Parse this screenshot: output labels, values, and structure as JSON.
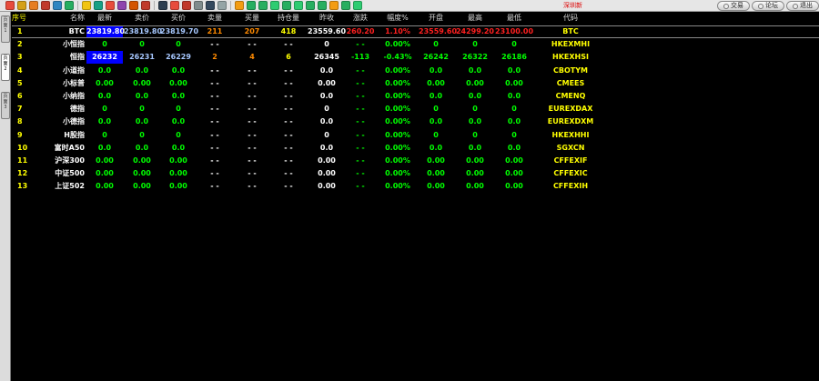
{
  "toolbar": {
    "status_text": "深圳新",
    "buttons": [
      {
        "label": "交易"
      },
      {
        "label": "论坛"
      },
      {
        "label": "退出"
      }
    ],
    "icons": [
      "house-icon",
      "stop-icon",
      "notebook-icon",
      "folder-icon",
      "table-icon",
      "grid-icon",
      "search-icon",
      "zoom-icon",
      "pointer-icon",
      "paint-icon",
      "pin-icon",
      "filter-icon",
      "grid2-icon",
      "chart-icon",
      "line-chart-icon",
      "list-icon",
      "table2-icon",
      "window-icon",
      "box1-icon",
      "box2-icon",
      "box3-icon",
      "box4-icon",
      "box5-icon",
      "box6-icon",
      "box7-icon",
      "box8-icon",
      "box9-icon",
      "box10-icon",
      "box11-icon"
    ]
  },
  "sidebar": {
    "tabs": [
      "页面 1",
      "页面 2",
      "页面 3"
    ]
  },
  "table": {
    "headers": [
      "序号",
      "名称",
      "最新",
      "卖价",
      "买价",
      "卖量",
      "买量",
      "持仓量",
      "昨收",
      "涨跌",
      "幅度%",
      "开盘",
      "最高",
      "最低",
      "代码"
    ],
    "rows": [
      [
        "1",
        "BTC",
        "23819.80",
        "23819.80",
        "23819.70",
        "211",
        "207",
        "418",
        "23559.60",
        "260.20",
        "1.10%",
        "23559.60",
        "24299.20",
        "23100.00",
        "BTC"
      ],
      [
        "2",
        "小恒指",
        "0",
        "0",
        "0",
        "- -",
        "- -",
        "- -",
        "0",
        "- -",
        "0.00%",
        "0",
        "0",
        "0",
        "HKEXMHI"
      ],
      [
        "3",
        "恒指",
        "26232",
        "26231",
        "26229",
        "2",
        "4",
        "6",
        "26345",
        "-113",
        "-0.43%",
        "26242",
        "26322",
        "26186",
        "HKEXHSI"
      ],
      [
        "4",
        "小道指",
        "0.0",
        "0.0",
        "0.0",
        "- -",
        "- -",
        "- -",
        "0.0",
        "- -",
        "0.00%",
        "0.0",
        "0.0",
        "0.0",
        "CBOTYM"
      ],
      [
        "5",
        "小标普",
        "0.00",
        "0.00",
        "0.00",
        "- -",
        "- -",
        "- -",
        "0.00",
        "- -",
        "0.00%",
        "0.00",
        "0.00",
        "0.00",
        "CMEES"
      ],
      [
        "6",
        "小纳指",
        "0.0",
        "0.0",
        "0.0",
        "- -",
        "- -",
        "- -",
        "0.0",
        "- -",
        "0.00%",
        "0.0",
        "0.0",
        "0.0",
        "CMENQ"
      ],
      [
        "7",
        "德指",
        "0",
        "0",
        "0",
        "- -",
        "- -",
        "- -",
        "0",
        "- -",
        "0.00%",
        "0",
        "0",
        "0",
        "EUREXDAX"
      ],
      [
        "8",
        "小德指",
        "0.0",
        "0.0",
        "0.0",
        "- -",
        "- -",
        "- -",
        "0.0",
        "- -",
        "0.00%",
        "0.0",
        "0.0",
        "0.0",
        "EUREXDXM"
      ],
      [
        "9",
        "H股指",
        "0",
        "0",
        "0",
        "- -",
        "- -",
        "- -",
        "0",
        "- -",
        "0.00%",
        "0",
        "0",
        "0",
        "HKEXHHI"
      ],
      [
        "10",
        "富时A50",
        "0.0",
        "0.0",
        "0.0",
        "- -",
        "- -",
        "- -",
        "0.0",
        "- -",
        "0.00%",
        "0.0",
        "0.0",
        "0.0",
        "SGXCN"
      ],
      [
        "11",
        "沪深300",
        "0.00",
        "0.00",
        "0.00",
        "- -",
        "- -",
        "- -",
        "0.00",
        "- -",
        "0.00%",
        "0.00",
        "0.00",
        "0.00",
        "CFFEXIF"
      ],
      [
        "12",
        "中证500",
        "0.00",
        "0.00",
        "0.00",
        "- -",
        "- -",
        "- -",
        "0.00",
        "- -",
        "0.00%",
        "0.00",
        "0.00",
        "0.00",
        "CFFEXIC"
      ],
      [
        "13",
        "上证502",
        "0.00",
        "0.00",
        "0.00",
        "- -",
        "- -",
        "- -",
        "0.00",
        "- -",
        "0.00%",
        "0.00",
        "0.00",
        "0.00",
        "CFFEXIH"
      ]
    ],
    "selected_row": 0,
    "highlighted_cells": [
      [
        0,
        2
      ],
      [
        2,
        2
      ]
    ]
  },
  "colors": {
    "background": "#000000",
    "header_text": "#ffff00",
    "up": "#ff2020",
    "down": "#00ff00",
    "highlight": "#0000ff",
    "quote_blue": "#a7c8ff",
    "volume_orange": "#ff8a00"
  }
}
